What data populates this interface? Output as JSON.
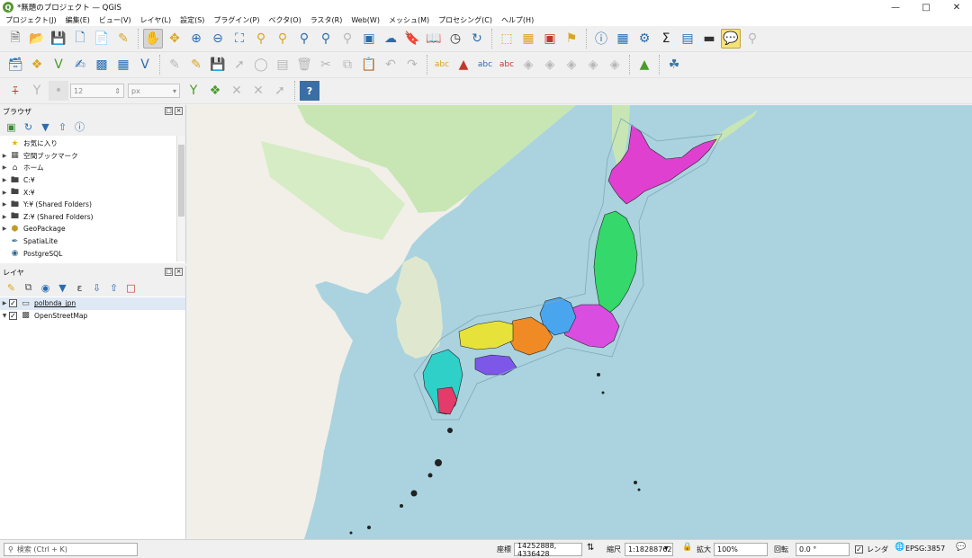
{
  "window": {
    "title": "*無題のプロジェクト — QGIS",
    "app_icon": "Q"
  },
  "menu": [
    "プロジェクト(J)",
    "編集(E)",
    "ビュー(V)",
    "レイヤ(L)",
    "設定(S)",
    "プラグイン(P)",
    "ベクタ(O)",
    "ラスタ(R)",
    "Web(W)",
    "メッシュ(M)",
    "プロセシング(C)",
    "ヘルプ(H)"
  ],
  "snapping": {
    "tolerance": "12",
    "unit": "px"
  },
  "browser": {
    "title": "ブラウザ",
    "items": [
      {
        "label": "お気に入り",
        "icon": "star-icon"
      },
      {
        "label": "空間ブックマーク",
        "icon": "bookmark-icon"
      },
      {
        "label": "ホーム",
        "icon": "home-icon"
      },
      {
        "label": "C:¥",
        "icon": "folder-icon"
      },
      {
        "label": "X:¥",
        "icon": "folder-icon"
      },
      {
        "label": "Y:¥ (Shared Folders)",
        "icon": "folder-icon"
      },
      {
        "label": "Z:¥ (Shared Folders)",
        "icon": "folder-icon"
      },
      {
        "label": "GeoPackage",
        "icon": "geopackage-icon"
      },
      {
        "label": "SpatiaLite",
        "icon": "spatialite-icon"
      },
      {
        "label": "PostgreSQL",
        "icon": "postgresql-icon"
      }
    ]
  },
  "layers": {
    "title": "レイヤ",
    "items": [
      {
        "label": "polbnda_jpn",
        "checked": true,
        "icon": "polygon-layer-icon"
      },
      {
        "label": "OpenStreetMap",
        "checked": true,
        "icon": "raster-tile-icon"
      }
    ]
  },
  "status": {
    "search_placeholder": "検索 (Ctrl + K)",
    "coord_label": "座標",
    "coord_value": "14252888, 4336428",
    "scale_label": "縮尺",
    "scale_value": "1:18288762",
    "magnifier_label": "拡大",
    "magnifier_value": "100%",
    "rotation_label": "回転",
    "rotation_value": "0.0 °",
    "render_label": "レンダ",
    "crs": "EPSG:3857"
  },
  "colors": {
    "sea": "#aad3df",
    "land": "#f2efe9",
    "forest": "#c8e6b4",
    "hokkaido": "#e040d0"
  }
}
